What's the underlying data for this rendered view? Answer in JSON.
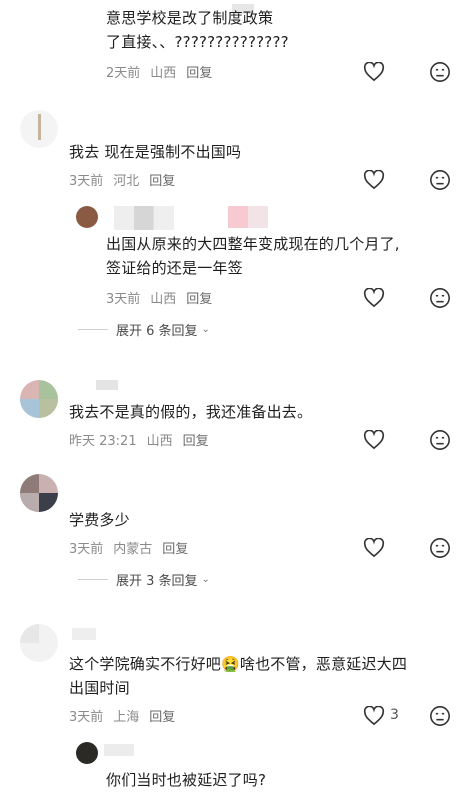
{
  "comments": [
    {
      "text": "意思学校是改了制度政策\n了直接、、??????????????",
      "time": "2天前",
      "location": "山西",
      "reply": "回复"
    },
    {
      "text": "我去 现在是强制不出国吗",
      "time": "3天前",
      "location": "河北",
      "reply": "回复"
    },
    {
      "text": "出国从原来的大四整年变成现在的几个月了,\n签证给的还是一年签",
      "time": "3天前",
      "location": "山西",
      "reply": "回复"
    },
    {
      "text": "我去不是真的假的，我还准备出去。",
      "time": "昨天 23:21",
      "location": "山西",
      "reply": "回复"
    },
    {
      "text": "学费多少",
      "time": "3天前",
      "location": "内蒙古",
      "reply": "回复"
    },
    {
      "text": "这个学院确实不行好吧🤮啥也不管，恶意延迟大四\n出国时间",
      "time": "3天前",
      "location": "上海",
      "reply": "回复",
      "likes": "3"
    },
    {
      "text": "你们当时也被延迟了吗?"
    }
  ],
  "expand_replies": [
    {
      "label": "展开 6 条回复"
    },
    {
      "label": "展开 3 条回复"
    }
  ],
  "icons": {
    "like": "heart-outline-icon",
    "dislike": "sad-face-icon",
    "expand": "chevron-down-icon"
  },
  "colors": {
    "meta": "#8a8a8a",
    "icon": "#333333",
    "divider": "#cfcfcf"
  }
}
